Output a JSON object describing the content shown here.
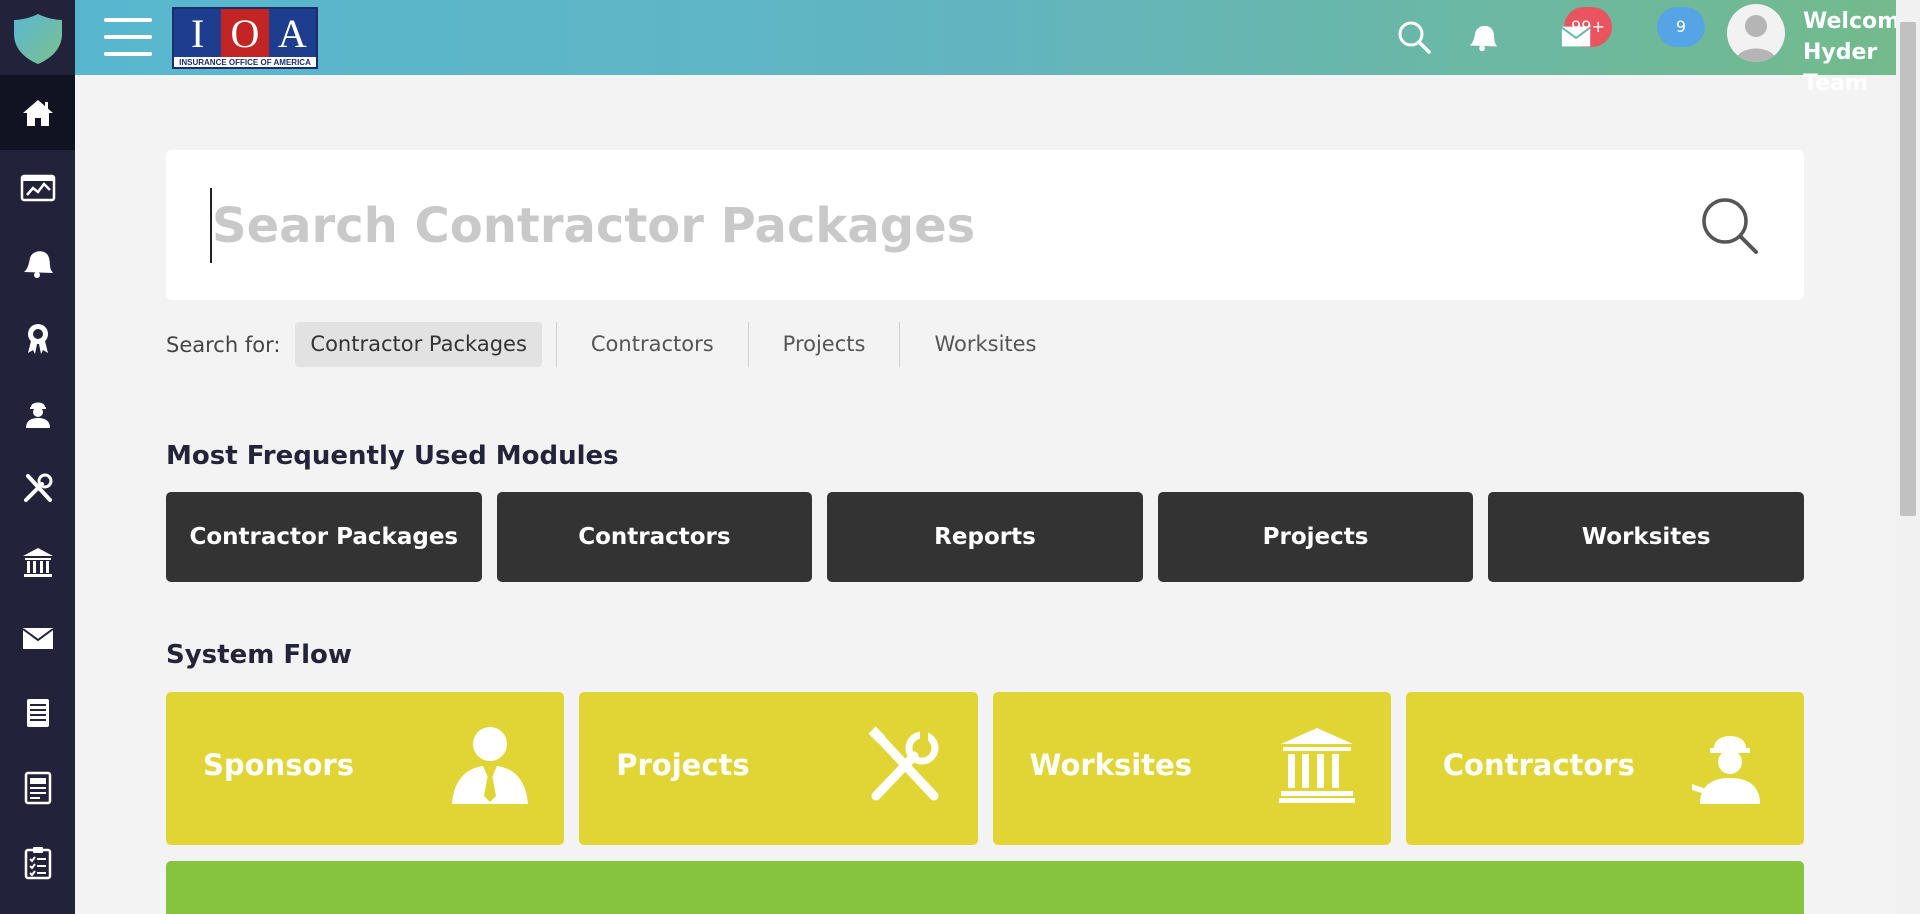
{
  "sidebar": {
    "items": [
      {
        "icon": "home-icon",
        "label": "Home"
      },
      {
        "icon": "dashboard-chart-icon",
        "label": "Dashboard"
      },
      {
        "icon": "notifications-bell-icon",
        "label": "Notifications"
      },
      {
        "icon": "award-ribbon-icon",
        "label": "Awards"
      },
      {
        "icon": "worker-icon",
        "label": "Contractors"
      },
      {
        "icon": "tools-icon",
        "label": "Projects"
      },
      {
        "icon": "institution-icon",
        "label": "Worksites"
      },
      {
        "icon": "envelope-icon",
        "label": "Messages"
      },
      {
        "icon": "document-icon",
        "label": "Documents"
      },
      {
        "icon": "report-icon",
        "label": "Reports"
      },
      {
        "icon": "clipboard-checklist-icon",
        "label": "Checklists"
      }
    ]
  },
  "header": {
    "brand": {
      "letters": [
        "I",
        "O",
        "A"
      ],
      "subtitle": "INSURANCE OFFICE OF AMERICA"
    },
    "notifications_badge": "99+",
    "messages_badge": "9",
    "welcome_line1": "Welcome",
    "welcome_line2": "Hyder Team"
  },
  "search": {
    "placeholder": "Search Contractor Packages",
    "value": "",
    "search_for_label": "Search for:",
    "options": [
      "Contractor Packages",
      "Contractors",
      "Projects",
      "Worksites"
    ],
    "active_option": "Contractor Packages"
  },
  "modules": {
    "title": "Most Frequently Used Modules",
    "items": [
      "Contractor Packages",
      "Contractors",
      "Reports",
      "Projects",
      "Worksites"
    ]
  },
  "system_flow": {
    "title": "System Flow",
    "items": [
      {
        "label": "Sponsors",
        "icon": "sponsor-person-icon"
      },
      {
        "label": "Projects",
        "icon": "tools-icon"
      },
      {
        "label": "Worksites",
        "icon": "institution-icon"
      },
      {
        "label": "Contractors",
        "icon": "worker-icon"
      }
    ]
  },
  "colors": {
    "sidebar": "#22233a",
    "module_button": "#333333",
    "flow_card": "#e1d535",
    "flow_bar_green": "#86c440",
    "badge_red": "#ea5461",
    "badge_blue": "#55a5e6"
  }
}
